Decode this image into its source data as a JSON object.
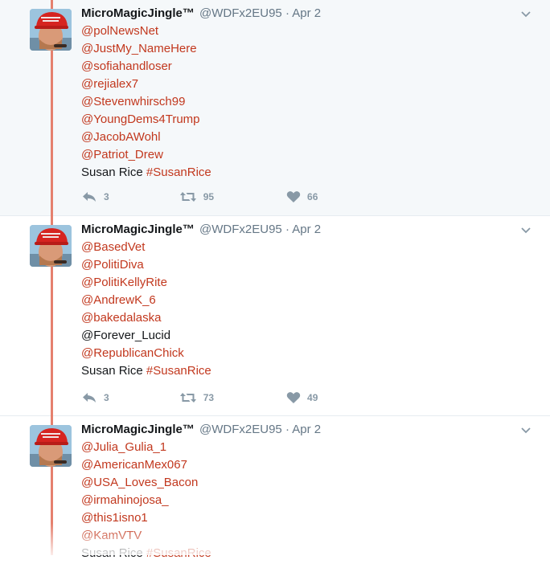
{
  "tweets": [
    {
      "name": "MicroMagicJingle™",
      "handle": "@WDFx2EU95",
      "date": "Apr 2",
      "lines": [
        {
          "text": "@polNewsNet",
          "type": "mention"
        },
        {
          "text": "@JustMy_NameHere",
          "type": "mention"
        },
        {
          "text": "@sofiahandloser",
          "type": "mention"
        },
        {
          "text": "@rejialex7",
          "type": "mention"
        },
        {
          "text": "@Stevenwhirsch99",
          "type": "mention"
        },
        {
          "text": "@YoungDems4Trump",
          "type": "mention"
        },
        {
          "text": "@JacobAWohl",
          "type": "mention"
        },
        {
          "text": "@Patriot_Drew",
          "type": "mention"
        }
      ],
      "footer_text": "Susan Rice",
      "footer_hashtag": "#SusanRice",
      "replies": "3",
      "retweets": "95",
      "likes": "66"
    },
    {
      "name": "MicroMagicJingle™",
      "handle": "@WDFx2EU95",
      "date": "Apr 2",
      "lines": [
        {
          "text": "@BasedVet",
          "type": "mention"
        },
        {
          "text": "@PolitiDiva",
          "type": "mention"
        },
        {
          "text": "@PolitiKellyRite",
          "type": "mention"
        },
        {
          "text": "@AndrewK_6",
          "type": "mention"
        },
        {
          "text": "@bakedalaska",
          "type": "mention"
        },
        {
          "text": "@Forever_Lucid",
          "type": "plain"
        },
        {
          "text": "@RepublicanChick",
          "type": "mention"
        }
      ],
      "footer_text": "Susan Rice",
      "footer_hashtag": "#SusanRice",
      "replies": "3",
      "retweets": "73",
      "likes": "49"
    },
    {
      "name": "MicroMagicJingle™",
      "handle": "@WDFx2EU95",
      "date": "Apr 2",
      "lines": [
        {
          "text": "@Julia_Gulia_1",
          "type": "mention"
        },
        {
          "text": "@AmericanMex067",
          "type": "mention"
        },
        {
          "text": "@USA_Loves_Bacon",
          "type": "mention"
        },
        {
          "text": "@irmahinojosa_",
          "type": "mention"
        },
        {
          "text": "@this1isno1",
          "type": "mention"
        },
        {
          "text": "@KamVTV",
          "type": "mention"
        }
      ],
      "footer_text": "Susan Rice",
      "footer_hashtag": "#SusanRice"
    }
  ],
  "separator": "·",
  "colors": {
    "mention": "#c2381e",
    "thread_line": "#e5806e",
    "muted": "#657786"
  },
  "icons": [
    "reply-icon",
    "retweet-icon",
    "like-icon",
    "chevron-down-icon"
  ]
}
